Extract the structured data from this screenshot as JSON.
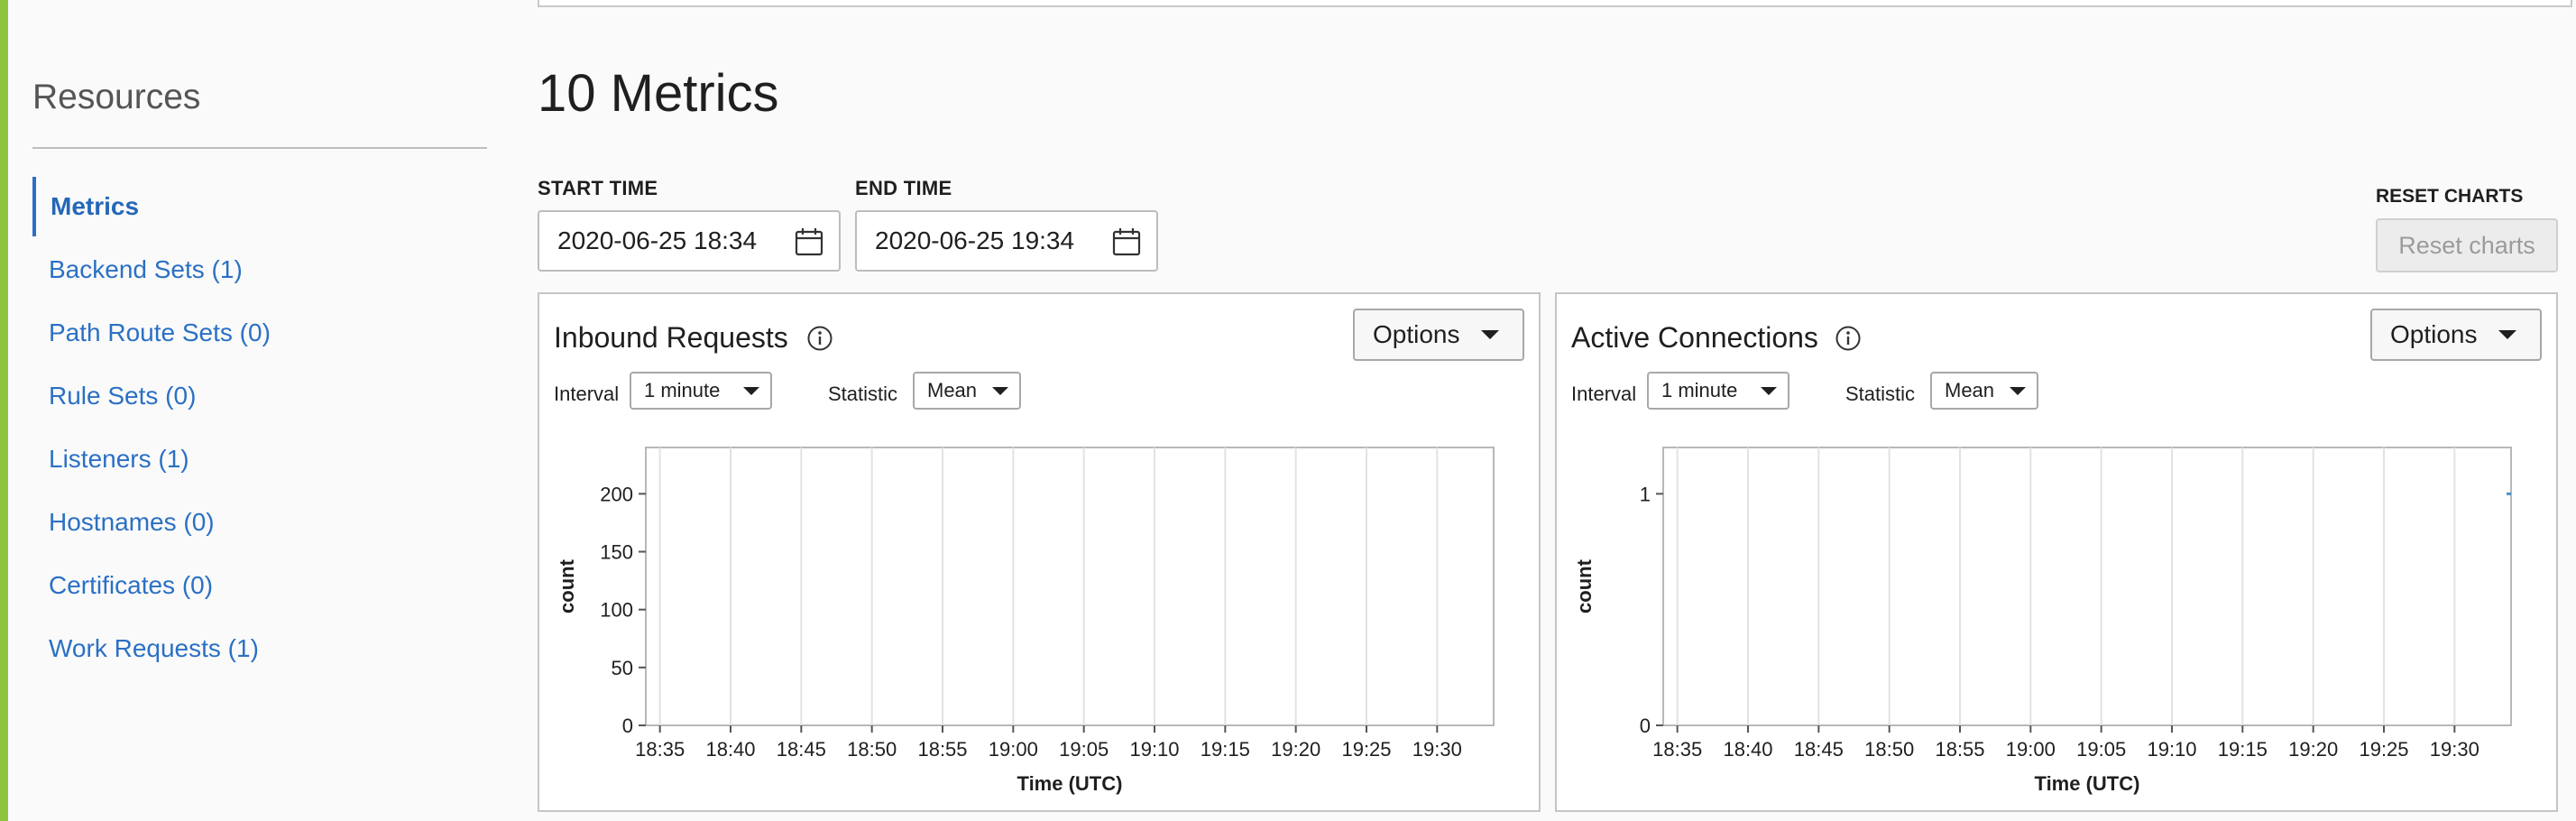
{
  "sidebar": {
    "title": "Resources",
    "items": [
      {
        "label": "Metrics",
        "active": true
      },
      {
        "label": "Backend Sets (1)",
        "active": false
      },
      {
        "label": "Path Route Sets (0)",
        "active": false
      },
      {
        "label": "Rule Sets (0)",
        "active": false
      },
      {
        "label": "Listeners (1)",
        "active": false
      },
      {
        "label": "Hostnames (0)",
        "active": false
      },
      {
        "label": "Certificates (0)",
        "active": false
      },
      {
        "label": "Work Requests (1)",
        "active": false
      }
    ]
  },
  "main": {
    "title": "10 Metrics",
    "start_time": {
      "label": "START TIME",
      "value": "2020-06-25 18:34"
    },
    "end_time": {
      "label": "END TIME",
      "value": "2020-06-25 19:34"
    },
    "reset": {
      "label": "RESET CHARTS",
      "button": "Reset charts"
    }
  },
  "colors": {
    "accent": "#8cc43f",
    "link": "#2b70c4",
    "series": "#4a90c8"
  },
  "panels": [
    {
      "title": "Inbound Requests",
      "options_label": "Options",
      "interval_label": "Interval",
      "interval_value": "1 minute",
      "statistic_label": "Statistic",
      "statistic_value": "Mean"
    },
    {
      "title": "Active Connections",
      "options_label": "Options",
      "interval_label": "Interval",
      "interval_value": "1 minute",
      "statistic_label": "Statistic",
      "statistic_value": "Mean"
    }
  ],
  "chart_data": [
    {
      "type": "line",
      "title": "Inbound Requests",
      "xlabel": "Time (UTC)",
      "ylabel": "count",
      "x_ticks": [
        "18:35",
        "18:40",
        "18:45",
        "18:50",
        "18:55",
        "19:00",
        "19:05",
        "19:10",
        "19:15",
        "19:20",
        "19:25",
        "19:30"
      ],
      "y_ticks": [
        0,
        50,
        100,
        150,
        200
      ],
      "ylim": [
        0,
        240
      ],
      "grid": true,
      "series": []
    },
    {
      "type": "line",
      "title": "Active Connections",
      "xlabel": "Time (UTC)",
      "ylabel": "count",
      "x_ticks": [
        "18:35",
        "18:40",
        "18:45",
        "18:50",
        "18:55",
        "19:00",
        "19:05",
        "19:10",
        "19:15",
        "19:20",
        "19:25",
        "19:30"
      ],
      "y_ticks": [
        0,
        1
      ],
      "ylim": [
        0,
        1.2
      ],
      "grid": true,
      "series": [
        {
          "x": [
            "19:34"
          ],
          "y": [
            1
          ]
        }
      ]
    }
  ]
}
